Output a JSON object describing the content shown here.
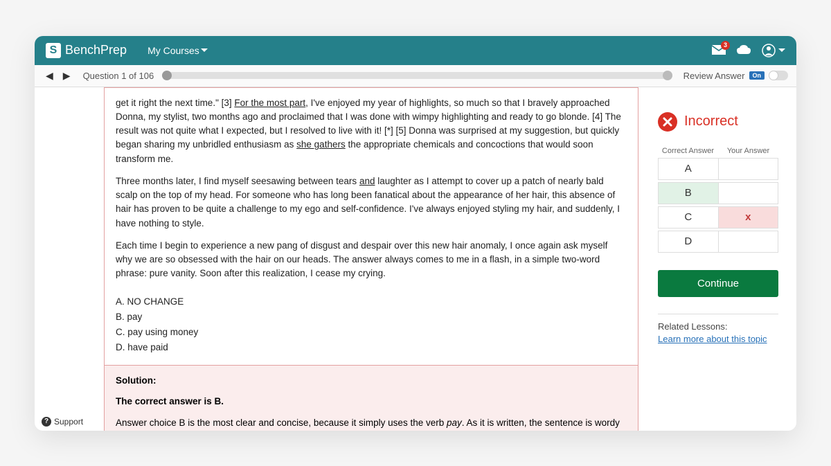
{
  "header": {
    "brand": "BenchPrep",
    "nav_my_courses": "My Courses",
    "notification_count": "3"
  },
  "subbar": {
    "question_counter": "Question 1 of 106",
    "review_label": "Review Answer",
    "toggle_state": "On"
  },
  "passage": {
    "para1_a": "get it right the next time.\" [3] ",
    "para1_u1": "For the most part",
    "para1_b": ", I've enjoyed my year of highlights, so much so that I bravely approached Donna, my stylist, two months ago and proclaimed that I was done with wimpy highlighting and ready to go blonde. [4] The result was not quite what I expected, but I resolved to live with it! [*] [5] Donna was surprised at my suggestion, but quickly began sharing my unbridled enthusiasm as ",
    "para1_u2": "she gathers",
    "para1_c": " the appropriate chemicals and concoctions that would soon transform me.",
    "para2_a": "Three months later, I find myself seesawing between tears ",
    "para2_u": "and",
    "para2_b": " laughter as I attempt to cover up a patch of nearly bald scalp on the top of my head. For someone who has long been fanatical about the appearance of her hair, this absence of hair has proven to be quite a challenge to my ego and self-confidence. I've always enjoyed styling my hair, and suddenly, I have nothing to style.",
    "para3": "Each time I begin to experience a new pang of disgust and despair over this new hair anomaly, I once again ask myself why we are so obsessed with the hair on our heads. The answer always comes to me in a flash, in a simple two-word phrase: pure vanity. Soon after this realization, I cease my crying.",
    "choice_a": "A.  NO CHANGE",
    "choice_b": "B.  pay",
    "choice_c": "C.  pay using money",
    "choice_d": "D.  have paid"
  },
  "solution": {
    "heading": "Solution:",
    "correct_stmt": "The correct answer is B.",
    "explain_a": "Answer choice B is the most clear and concise, because it simply uses the verb ",
    "explain_i": "pay",
    "explain_b": ". As it is written, the sentence is wordy and redundant. Answer choice C sounds awkward and is grammatically incorrect. Answer choice D is written in the past tense while the rest of the sentence is written in the present tense."
  },
  "result": {
    "label": "Incorrect",
    "header_correct": "Correct Answer",
    "header_your": "Your Answer",
    "options": [
      "A",
      "B",
      "C",
      "D"
    ],
    "correct": "B",
    "user": "C",
    "user_mark": "x",
    "continue_label": "Continue",
    "related_label": "Related Lessons:",
    "related_link": "Learn more about this topic"
  },
  "support_label": "Support"
}
